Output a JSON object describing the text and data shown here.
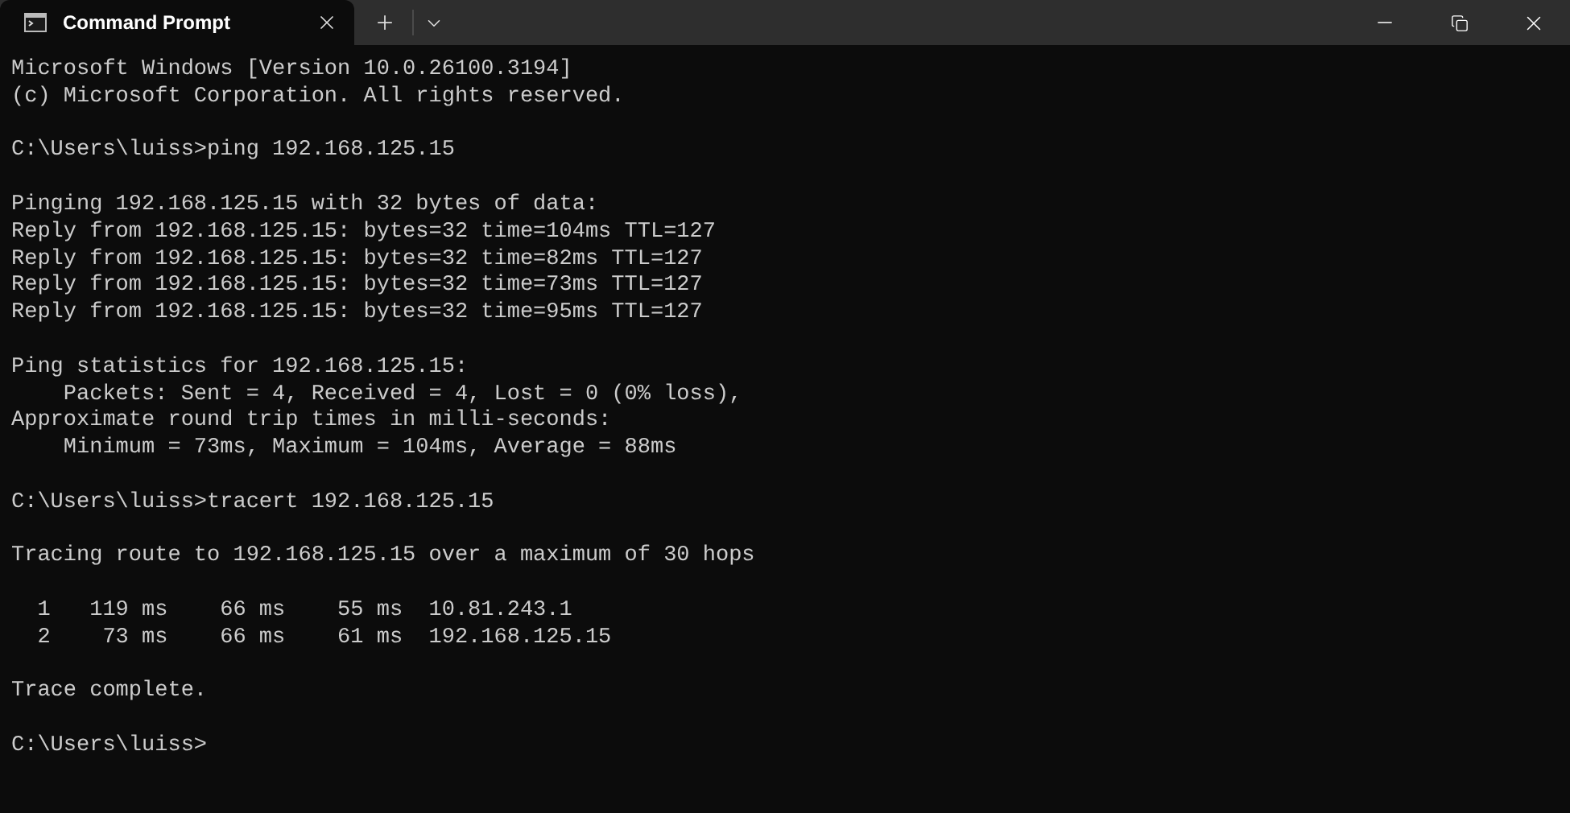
{
  "tab": {
    "title": "Command Prompt",
    "selected": true
  },
  "output": [
    {
      "lines": [
        "Microsoft Windows [Version 10.0.26100.3194]",
        "(c) Microsoft Corporation. All rights reserved."
      ]
    },
    {
      "lines": [
        "C:\\Users\\luiss>ping 192.168.125.15"
      ]
    },
    {
      "lines": [
        "Pinging 192.168.125.15 with 32 bytes of data:",
        "Reply from 192.168.125.15: bytes=32 time=104ms TTL=127",
        "Reply from 192.168.125.15: bytes=32 time=82ms TTL=127",
        "Reply from 192.168.125.15: bytes=32 time=73ms TTL=127",
        "Reply from 192.168.125.15: bytes=32 time=95ms TTL=127"
      ]
    },
    {
      "lines": [
        "Ping statistics for 192.168.125.15:",
        "    Packets: Sent = 4, Received = 4, Lost = 0 (0% loss),",
        "Approximate round trip times in milli-seconds:",
        "    Minimum = 73ms, Maximum = 104ms, Average = 88ms"
      ]
    },
    {
      "lines": [
        "C:\\Users\\luiss>tracert 192.168.125.15"
      ]
    },
    {
      "lines": [
        "Tracing route to 192.168.125.15 over a maximum of 30 hops"
      ]
    },
    {
      "lines": [
        "  1   119 ms    66 ms    55 ms  10.81.243.1",
        "  2    73 ms    66 ms    61 ms  192.168.125.15"
      ]
    },
    {
      "lines": [
        "Trace complete."
      ]
    },
    {
      "lines": [
        "C:\\Users\\luiss>"
      ]
    }
  ]
}
